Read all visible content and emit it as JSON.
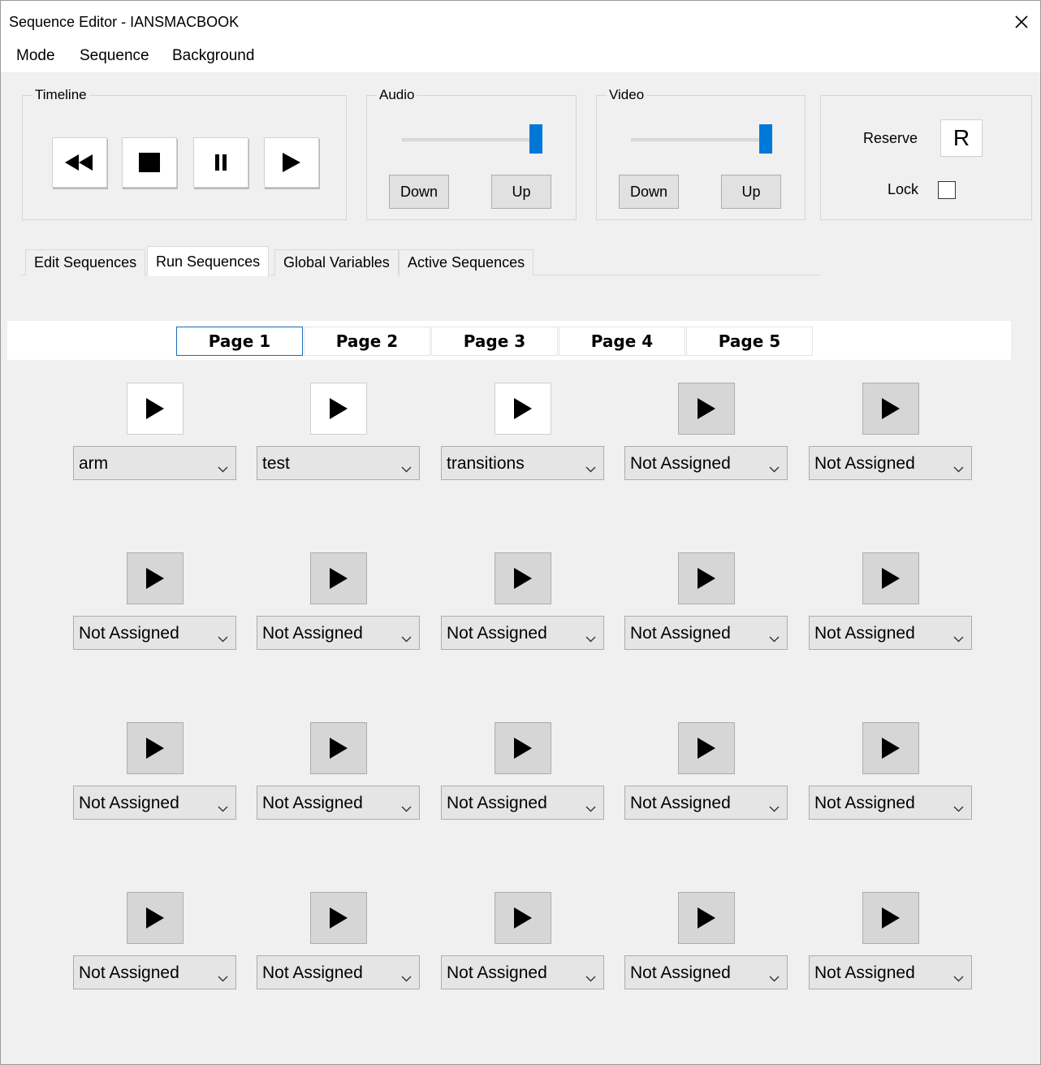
{
  "window": {
    "title": "Sequence Editor - IANSMACBOOK",
    "close_icon": "close-icon"
  },
  "menu": [
    "Mode",
    "Sequence",
    "Background"
  ],
  "timeline": {
    "label": "Timeline",
    "buttons": [
      "rewind-icon",
      "stop-icon",
      "pause-icon",
      "play-icon"
    ]
  },
  "audio": {
    "label": "Audio",
    "down": "Down",
    "up": "Up",
    "level": 1.0
  },
  "video": {
    "label": "Video",
    "down": "Down",
    "up": "Up",
    "level": 1.0
  },
  "reserve": {
    "label": "Reserve",
    "button": "R",
    "lock_label": "Lock",
    "lock_checked": false
  },
  "tabs": [
    {
      "label": "Edit Sequences",
      "active": false
    },
    {
      "label": "Run Sequences",
      "active": true
    },
    {
      "label": "Global Variables",
      "active": false
    },
    {
      "label": "Active Sequences",
      "active": false
    }
  ],
  "pages": [
    {
      "label": "Page 1",
      "active": true
    },
    {
      "label": "Page 2",
      "active": false
    },
    {
      "label": "Page 3",
      "active": false
    },
    {
      "label": "Page 4",
      "active": false
    },
    {
      "label": "Page 5",
      "active": false
    }
  ],
  "grid": [
    [
      "arm",
      "test",
      "transitions",
      "Not Assigned",
      "Not Assigned"
    ],
    [
      "Not Assigned",
      "Not Assigned",
      "Not Assigned",
      "Not Assigned",
      "Not Assigned"
    ],
    [
      "Not Assigned",
      "Not Assigned",
      "Not Assigned",
      "Not Assigned",
      "Not Assigned"
    ],
    [
      "Not Assigned",
      "Not Assigned",
      "Not Assigned",
      "Not Assigned",
      "Not Assigned"
    ]
  ],
  "colors": {
    "accent": "#0078d7",
    "active_page_border": "#1e6bbd",
    "window_bg": "#f0f0f0"
  }
}
